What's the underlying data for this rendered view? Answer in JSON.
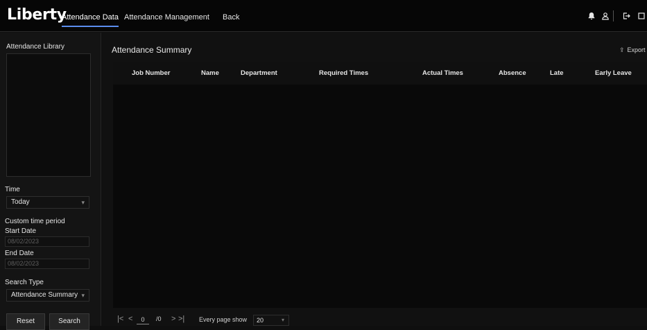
{
  "header": {
    "logo": "Liberty",
    "nav": [
      {
        "label": "Attendance Data",
        "active": true
      },
      {
        "label": "Attendance Management",
        "active": false
      },
      {
        "label": "Back",
        "active": false
      }
    ],
    "icons": [
      "bell-icon",
      "user-icon",
      "logout-icon",
      "fullscreen-icon"
    ]
  },
  "sidebar": {
    "library_label": "Attendance Library",
    "time_label": "Time",
    "time_value": "Today",
    "custom_label": "Custom time period",
    "start_label": "Start Date",
    "start_value": "08/02/2023",
    "end_label": "End Date",
    "end_value": "08/02/2023",
    "search_type_label": "Search Type",
    "search_type_value": "Attendance Summary",
    "reset_label": "Reset",
    "search_label": "Search"
  },
  "main": {
    "title": "Attendance Summary",
    "export_label": "Export",
    "columns": [
      "Job Number",
      "Name",
      "Department",
      "Required Times",
      "Actual Times",
      "Absence",
      "Late",
      "Early Leave"
    ]
  },
  "pagination": {
    "first": "|<",
    "prev": "<",
    "current": "0",
    "total": "/0",
    "next": ">",
    "last": ">|",
    "page_size_label": "Every page show",
    "page_size_value": "20"
  },
  "colors": {
    "accent": "#5b8def",
    "background": "#0f0f0f",
    "panel": "#141414"
  }
}
